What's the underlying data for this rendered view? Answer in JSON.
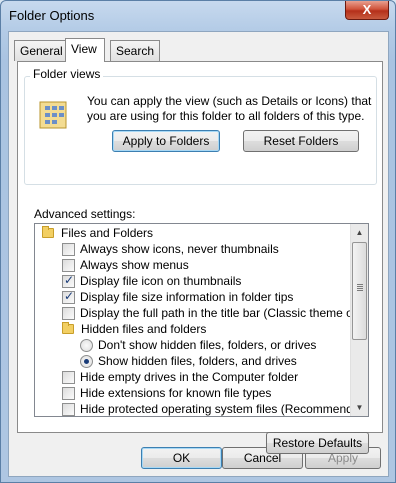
{
  "window": {
    "title": "Folder Options",
    "close_glyph": "X"
  },
  "tabs": [
    "General",
    "View",
    "Search"
  ],
  "folder_views": {
    "title": "Folder views",
    "description": "You can apply the view (such as Details or Icons) that you are using for this folder to all folders of this type.",
    "apply_label": "Apply to Folders",
    "reset_label": "Reset Folders"
  },
  "advanced": {
    "label": "Advanced settings:",
    "items": [
      {
        "type": "folder",
        "label": "Files and Folders"
      },
      {
        "type": "checkbox",
        "label": "Always show icons, never thumbnails",
        "checked": false
      },
      {
        "type": "checkbox",
        "label": "Always show menus",
        "checked": false
      },
      {
        "type": "checkbox",
        "label": "Display file icon on thumbnails",
        "checked": true
      },
      {
        "type": "checkbox",
        "label": "Display file size information in folder tips",
        "checked": true
      },
      {
        "type": "checkbox",
        "label": "Display the full path in the title bar (Classic theme only)",
        "checked": false
      },
      {
        "type": "folder",
        "label": "Hidden files and folders"
      },
      {
        "type": "radio",
        "label": "Don't show hidden files, folders, or drives",
        "checked": false
      },
      {
        "type": "radio",
        "label": "Show hidden files, folders, and drives",
        "checked": true
      },
      {
        "type": "checkbox",
        "label": "Hide empty drives in the Computer folder",
        "checked": false
      },
      {
        "type": "checkbox",
        "label": "Hide extensions for known file types",
        "checked": false
      },
      {
        "type": "checkbox",
        "label": "Hide protected operating system files (Recommended)",
        "checked": false
      }
    ]
  },
  "buttons": {
    "restore": "Restore Defaults",
    "ok": "OK",
    "cancel": "Cancel",
    "apply": "Apply"
  },
  "icons": {
    "close": "close-icon",
    "folder_views": "folder-views-icon",
    "folder": "folder-icon",
    "scroll_up": "scroll-up-arrow-icon",
    "scroll_down": "scroll-down-arrow-icon"
  },
  "colors": {
    "accent": "#3c7fb1",
    "checkmark": "#1a3c78",
    "disabled_text": "#8a8a8a"
  }
}
